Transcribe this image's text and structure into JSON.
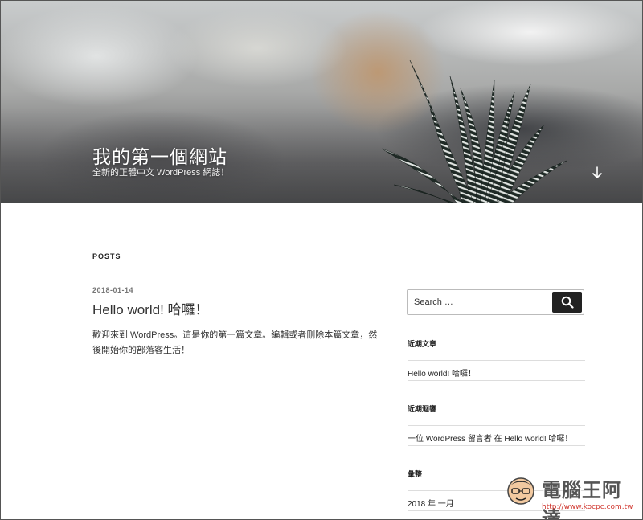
{
  "header": {
    "site_title": "我的第一個網站",
    "site_description": "全新的正體中文 WordPress 網誌！",
    "scroll_icon": "arrow-down-icon",
    "image_subject": "zebra-plant"
  },
  "main": {
    "section_heading": "POSTS",
    "post": {
      "date": "2018-01-14",
      "title": "Hello world! 哈囉！",
      "excerpt": "歡迎來到 WordPress。這是你的第一篇文章。編輯或者刪除本篇文章，然後開始你的部落客生活！"
    }
  },
  "sidebar": {
    "search": {
      "placeholder": "Search …",
      "button_icon": "search-icon"
    },
    "recent_posts": {
      "title": "近期文章",
      "items": [
        "Hello world! 哈囉！"
      ]
    },
    "recent_comments": {
      "title": "近期迴響",
      "items": [
        "一位 WordPress 留言者 在 Hello world! 哈囉！"
      ]
    },
    "archives": {
      "title": "彙整",
      "items": [
        "2018 年 一月"
      ]
    }
  },
  "watermark": {
    "brand": "電腦王阿達",
    "url": "http://www.kocpc.com.tw"
  },
  "colors": {
    "search_button": "#222222",
    "watermark_url": "#d0342c"
  }
}
